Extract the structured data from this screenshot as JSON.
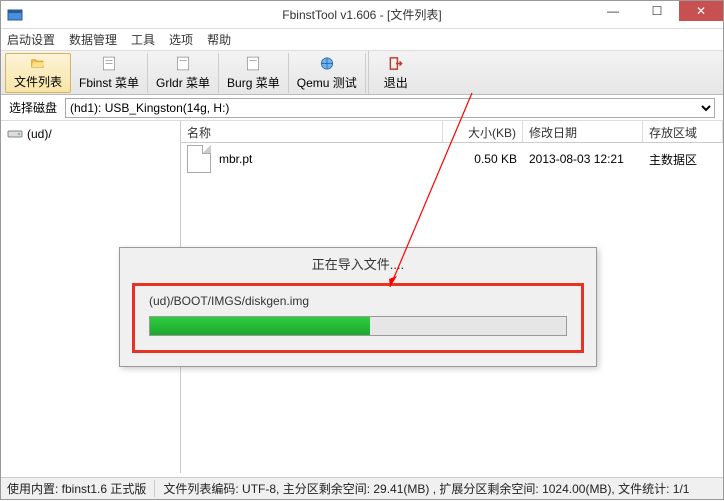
{
  "window": {
    "title": "FbinstTool v1.606 - [文件列表]"
  },
  "menu": {
    "items": [
      "启动设置",
      "数据管理",
      "工具",
      "选项",
      "帮助"
    ]
  },
  "toolbar": {
    "filelist": "文件列表",
    "fbinst": "Fbinst 菜单",
    "grldr": "Grldr 菜单",
    "burg": "Burg 菜单",
    "qemu": "Qemu 测试",
    "exit": "退出"
  },
  "disk": {
    "label": "选择磁盘",
    "selected": "(hd1): USB_Kingston(14g, H:)"
  },
  "tree": {
    "root": "(ud)/"
  },
  "columns": {
    "name": "名称",
    "size": "大小(KB)",
    "date": "修改日期",
    "area": "存放区域"
  },
  "rows": [
    {
      "name": "mbr.pt",
      "size": "0.50 KB",
      "date": "2013-08-03 12:21",
      "area": "主数据区"
    }
  ],
  "dialog": {
    "title": "正在导入文件....",
    "path": "(ud)/BOOT/IMGS/diskgen.img",
    "progress_pct": 53
  },
  "status": {
    "engine": "使用内置: fbinst1.6 正式版",
    "info": "文件列表编码: UTF-8, 主分区剩余空间:    29.41(MB) , 扩展分区剩余空间:    1024.00(MB), 文件统计: 1/1"
  }
}
